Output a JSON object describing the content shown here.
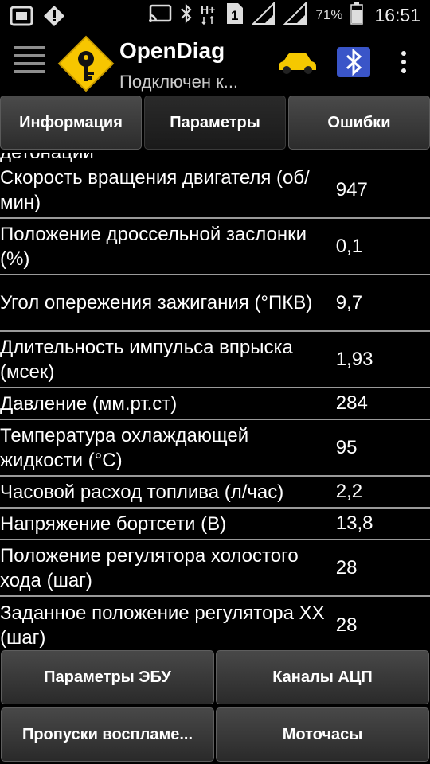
{
  "status_bar": {
    "battery": "71%",
    "time": "16:51",
    "icons": [
      "screenshot-icon",
      "warning-diamond-icon",
      "cast-icon",
      "bluetooth-icon",
      "h-plus-icon",
      "sim-1-icon",
      "signal-1-icon",
      "signal-2-icon",
      "battery-icon"
    ]
  },
  "app_bar": {
    "title": "OpenDiag",
    "subtitle": "Подключен к...",
    "icons": [
      "menu-icon",
      "app-logo-icon",
      "car-icon",
      "bluetooth-device-icon",
      "overflow-menu-icon"
    ],
    "car_color": "#f5c800"
  },
  "tabs": [
    {
      "label": "Информация"
    },
    {
      "label": "Параметры"
    },
    {
      "label": "Ошибки"
    }
  ],
  "list": {
    "partial_top": "детонации",
    "rows": [
      {
        "name": "Скорость вращения двигателя (об/мин)",
        "value": "947"
      },
      {
        "name": "Положение дроссельной заслонки (%)",
        "value": "0,1"
      },
      {
        "name": "Угол опережения зажигания (°ПКВ)",
        "value": "9,7"
      },
      {
        "name": "Длительность импульса впрыска (мсек)",
        "value": "1,93"
      },
      {
        "name": "Давление (мм.рт.ст)",
        "value": "284"
      },
      {
        "name": "Температура охлаждающей жидкости (°C)",
        "value": "95"
      },
      {
        "name": "Часовой расход топлива (л/час)",
        "value": "2,2"
      },
      {
        "name": "Напряжение бортсети (В)",
        "value": "13,8"
      },
      {
        "name": "Положение регулятора холостого хода (шаг)",
        "value": "28"
      },
      {
        "name": "Заданное положение регулятора XX (шаг)",
        "value": "28"
      }
    ]
  },
  "buttons": {
    "ecu_params": "Параметры ЭБУ",
    "adc_channels": "Каналы АЦП",
    "misfires": "Пропуски воспламе...",
    "engine_hours": "Моточасы"
  }
}
